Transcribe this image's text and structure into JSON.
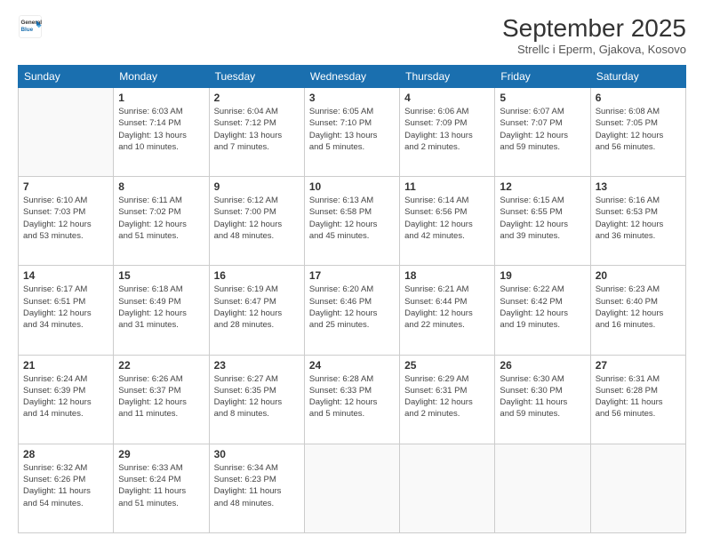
{
  "header": {
    "logo_general": "General",
    "logo_blue": "Blue",
    "title": "September 2025",
    "subtitle": "Strellc i Eperm, Gjakova, Kosovo"
  },
  "days_of_week": [
    "Sunday",
    "Monday",
    "Tuesday",
    "Wednesday",
    "Thursday",
    "Friday",
    "Saturday"
  ],
  "weeks": [
    [
      {
        "day": "",
        "info": ""
      },
      {
        "day": "1",
        "info": "Sunrise: 6:03 AM\nSunset: 7:14 PM\nDaylight: 13 hours\nand 10 minutes."
      },
      {
        "day": "2",
        "info": "Sunrise: 6:04 AM\nSunset: 7:12 PM\nDaylight: 13 hours\nand 7 minutes."
      },
      {
        "day": "3",
        "info": "Sunrise: 6:05 AM\nSunset: 7:10 PM\nDaylight: 13 hours\nand 5 minutes."
      },
      {
        "day": "4",
        "info": "Sunrise: 6:06 AM\nSunset: 7:09 PM\nDaylight: 13 hours\nand 2 minutes."
      },
      {
        "day": "5",
        "info": "Sunrise: 6:07 AM\nSunset: 7:07 PM\nDaylight: 12 hours\nand 59 minutes."
      },
      {
        "day": "6",
        "info": "Sunrise: 6:08 AM\nSunset: 7:05 PM\nDaylight: 12 hours\nand 56 minutes."
      }
    ],
    [
      {
        "day": "7",
        "info": "Sunrise: 6:10 AM\nSunset: 7:03 PM\nDaylight: 12 hours\nand 53 minutes."
      },
      {
        "day": "8",
        "info": "Sunrise: 6:11 AM\nSunset: 7:02 PM\nDaylight: 12 hours\nand 51 minutes."
      },
      {
        "day": "9",
        "info": "Sunrise: 6:12 AM\nSunset: 7:00 PM\nDaylight: 12 hours\nand 48 minutes."
      },
      {
        "day": "10",
        "info": "Sunrise: 6:13 AM\nSunset: 6:58 PM\nDaylight: 12 hours\nand 45 minutes."
      },
      {
        "day": "11",
        "info": "Sunrise: 6:14 AM\nSunset: 6:56 PM\nDaylight: 12 hours\nand 42 minutes."
      },
      {
        "day": "12",
        "info": "Sunrise: 6:15 AM\nSunset: 6:55 PM\nDaylight: 12 hours\nand 39 minutes."
      },
      {
        "day": "13",
        "info": "Sunrise: 6:16 AM\nSunset: 6:53 PM\nDaylight: 12 hours\nand 36 minutes."
      }
    ],
    [
      {
        "day": "14",
        "info": "Sunrise: 6:17 AM\nSunset: 6:51 PM\nDaylight: 12 hours\nand 34 minutes."
      },
      {
        "day": "15",
        "info": "Sunrise: 6:18 AM\nSunset: 6:49 PM\nDaylight: 12 hours\nand 31 minutes."
      },
      {
        "day": "16",
        "info": "Sunrise: 6:19 AM\nSunset: 6:47 PM\nDaylight: 12 hours\nand 28 minutes."
      },
      {
        "day": "17",
        "info": "Sunrise: 6:20 AM\nSunset: 6:46 PM\nDaylight: 12 hours\nand 25 minutes."
      },
      {
        "day": "18",
        "info": "Sunrise: 6:21 AM\nSunset: 6:44 PM\nDaylight: 12 hours\nand 22 minutes."
      },
      {
        "day": "19",
        "info": "Sunrise: 6:22 AM\nSunset: 6:42 PM\nDaylight: 12 hours\nand 19 minutes."
      },
      {
        "day": "20",
        "info": "Sunrise: 6:23 AM\nSunset: 6:40 PM\nDaylight: 12 hours\nand 16 minutes."
      }
    ],
    [
      {
        "day": "21",
        "info": "Sunrise: 6:24 AM\nSunset: 6:39 PM\nDaylight: 12 hours\nand 14 minutes."
      },
      {
        "day": "22",
        "info": "Sunrise: 6:26 AM\nSunset: 6:37 PM\nDaylight: 12 hours\nand 11 minutes."
      },
      {
        "day": "23",
        "info": "Sunrise: 6:27 AM\nSunset: 6:35 PM\nDaylight: 12 hours\nand 8 minutes."
      },
      {
        "day": "24",
        "info": "Sunrise: 6:28 AM\nSunset: 6:33 PM\nDaylight: 12 hours\nand 5 minutes."
      },
      {
        "day": "25",
        "info": "Sunrise: 6:29 AM\nSunset: 6:31 PM\nDaylight: 12 hours\nand 2 minutes."
      },
      {
        "day": "26",
        "info": "Sunrise: 6:30 AM\nSunset: 6:30 PM\nDaylight: 11 hours\nand 59 minutes."
      },
      {
        "day": "27",
        "info": "Sunrise: 6:31 AM\nSunset: 6:28 PM\nDaylight: 11 hours\nand 56 minutes."
      }
    ],
    [
      {
        "day": "28",
        "info": "Sunrise: 6:32 AM\nSunset: 6:26 PM\nDaylight: 11 hours\nand 54 minutes."
      },
      {
        "day": "29",
        "info": "Sunrise: 6:33 AM\nSunset: 6:24 PM\nDaylight: 11 hours\nand 51 minutes."
      },
      {
        "day": "30",
        "info": "Sunrise: 6:34 AM\nSunset: 6:23 PM\nDaylight: 11 hours\nand 48 minutes."
      },
      {
        "day": "",
        "info": ""
      },
      {
        "day": "",
        "info": ""
      },
      {
        "day": "",
        "info": ""
      },
      {
        "day": "",
        "info": ""
      }
    ]
  ]
}
